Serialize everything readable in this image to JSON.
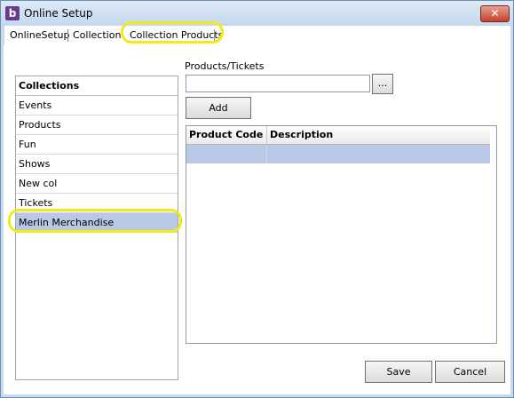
{
  "window": {
    "title": "Online Setup",
    "close_label": "✕",
    "app_icon_letter": "b"
  },
  "tabs": [
    {
      "label": "OnlineSetup"
    },
    {
      "label": "Collections"
    },
    {
      "label": "Collection Products"
    }
  ],
  "collections": {
    "header": "Collections",
    "items": [
      {
        "label": "Events"
      },
      {
        "label": "Products"
      },
      {
        "label": "Fun"
      },
      {
        "label": "Shows"
      },
      {
        "label": "New col"
      },
      {
        "label": "Tickets"
      },
      {
        "label": "Merlin Merchandise",
        "selected": true
      }
    ]
  },
  "products": {
    "label": "Products/Tickets",
    "input_value": "",
    "browse_label": "...",
    "add_label": "Add"
  },
  "grid": {
    "columns": [
      "Product Code",
      "Description"
    ]
  },
  "footer": {
    "save_label": "Save",
    "cancel_label": "Cancel"
  },
  "colors": {
    "selection": "#b8c8e6",
    "highlight_annotation": "#f2ea1a"
  }
}
